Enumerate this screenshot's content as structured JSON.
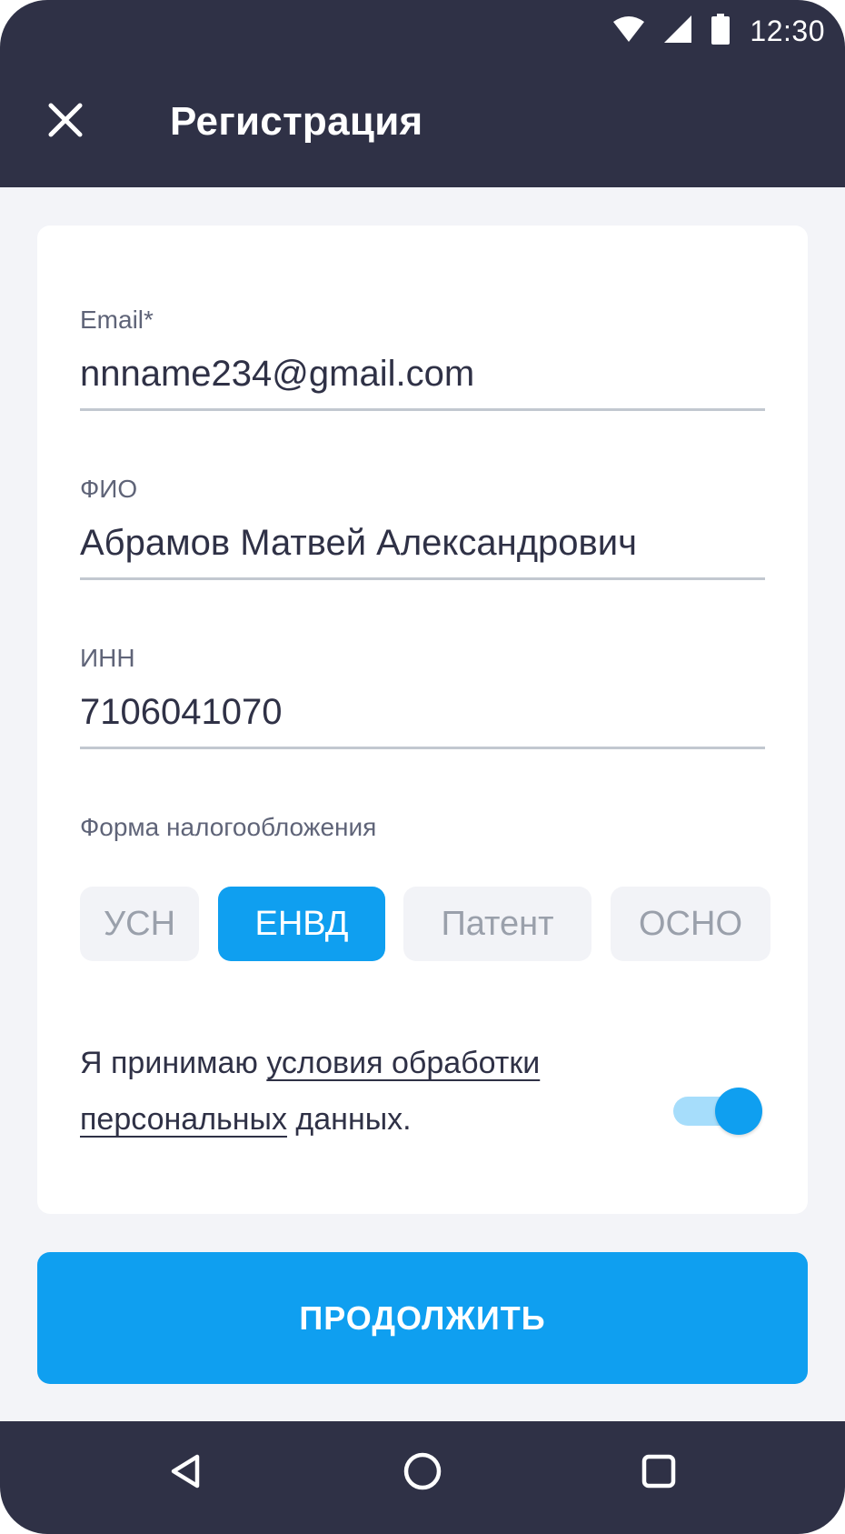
{
  "status_bar": {
    "time": "12:30",
    "icons": [
      "wifi-icon",
      "signal-icon",
      "battery-icon"
    ]
  },
  "app_bar": {
    "close_icon": "close-icon",
    "title": "Регистрация"
  },
  "form": {
    "email": {
      "label": "Email*",
      "value": "nnname234@gmail.com"
    },
    "fio": {
      "label": "ФИО",
      "value": "Абрамов Матвей Александрович"
    },
    "inn": {
      "label": "ИНН",
      "value": "7106041070"
    },
    "tax": {
      "label": "Форма налогообложения",
      "options": [
        "УСН",
        "ЕНВД",
        "Патент",
        "ОСНО"
      ],
      "selected": "ЕНВД"
    },
    "consent": {
      "prefix": "Я принимаю ",
      "link": "условия обработки персональных",
      "suffix": " данных.",
      "accepted": true
    }
  },
  "continue_button": {
    "label": "ПРОДОЛЖИТЬ"
  },
  "nav_bar": {
    "icons": [
      "back-icon",
      "home-icon",
      "recents-icon"
    ]
  },
  "colors": {
    "header_bg": "#2f3146",
    "accent": "#0f9ff0",
    "page_bg": "#f3f4f8",
    "chip_bg": "#f2f3f7",
    "toggle_track": "#a6ddfb"
  }
}
